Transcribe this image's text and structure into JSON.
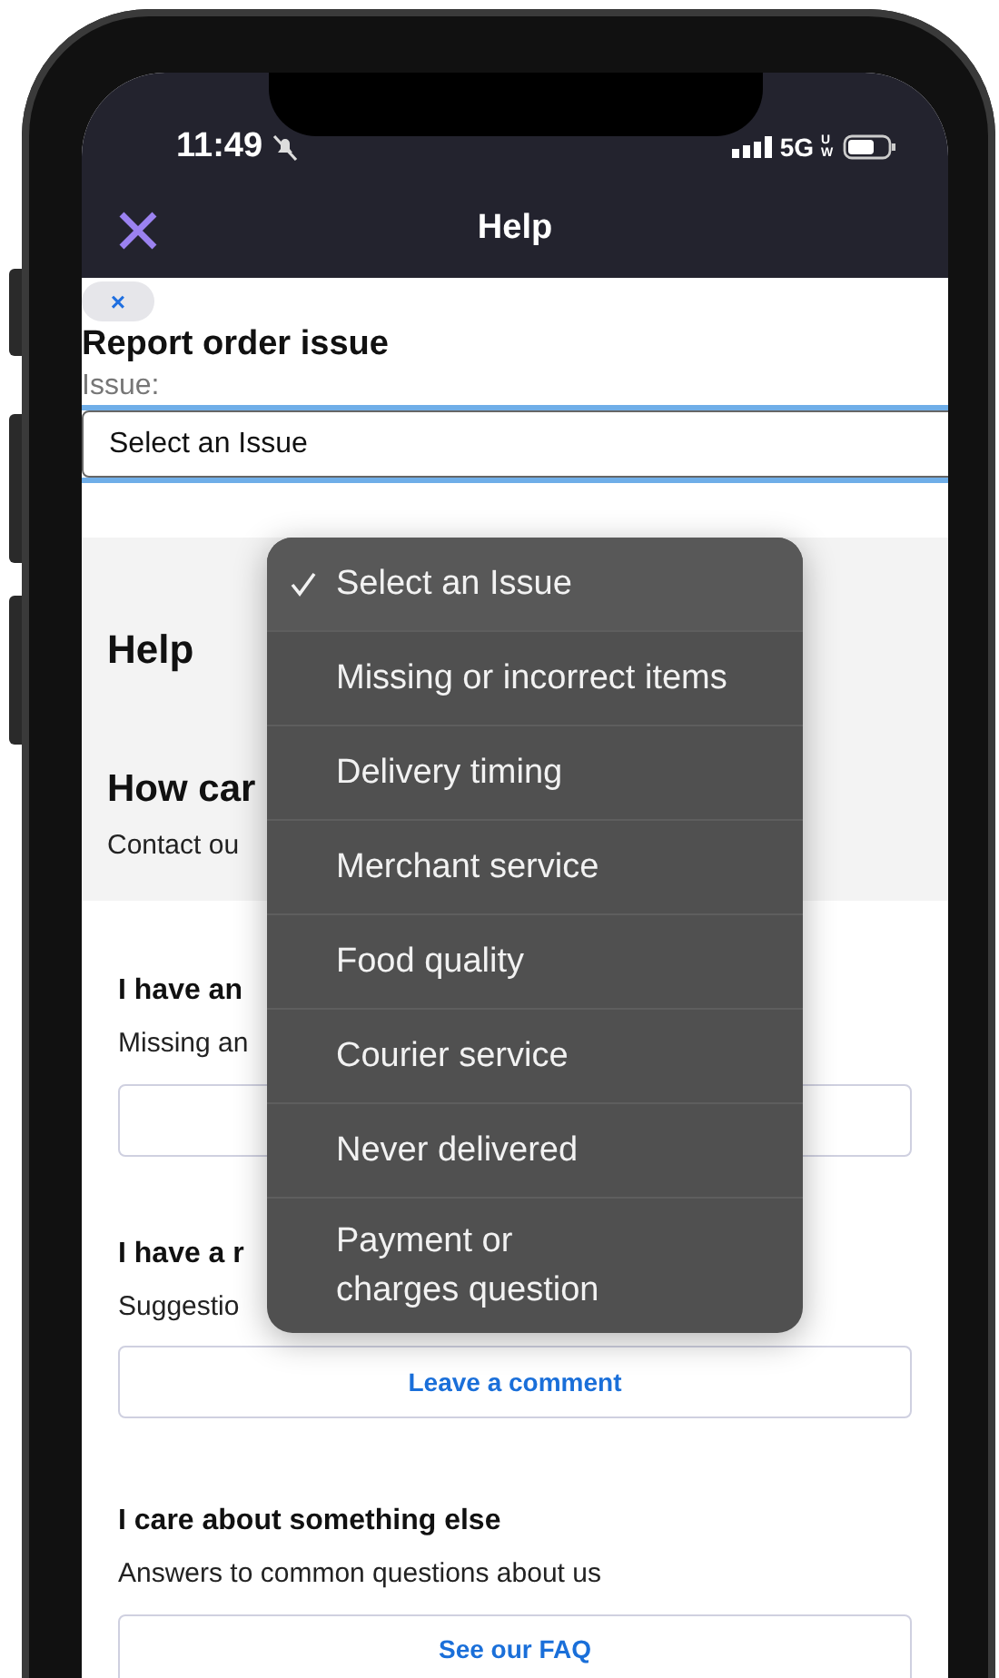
{
  "status_bar": {
    "time": "11:49",
    "network": "5G",
    "network_sup": "UW"
  },
  "nav": {
    "title": "Help"
  },
  "report": {
    "close_chip": "×",
    "title": "Report order issue",
    "label": "Issue:",
    "value": "Select an Issue"
  },
  "issue_menu": [
    {
      "label": "Select an Issue",
      "selected": true
    },
    {
      "label": "Missing or incorrect items",
      "selected": false
    },
    {
      "label": "Delivery timing",
      "selected": false
    },
    {
      "label": "Merchant service",
      "selected": false
    },
    {
      "label": "Food quality",
      "selected": false
    },
    {
      "label": "Courier service",
      "selected": false
    },
    {
      "label": "Never delivered",
      "selected": false
    },
    {
      "label": "Payment or\ncharges question",
      "selected": false
    }
  ],
  "help": {
    "title": "Help",
    "subtitle": "How car",
    "text": "Contact ou"
  },
  "sections": [
    {
      "title": "I have an",
      "text": "Missing an"
    },
    {
      "title": "I have a r",
      "text": "Suggestio",
      "button": "Leave a comment"
    },
    {
      "title": "I care about something else",
      "text": "Answers to common questions about us",
      "button": "See our FAQ"
    }
  ]
}
